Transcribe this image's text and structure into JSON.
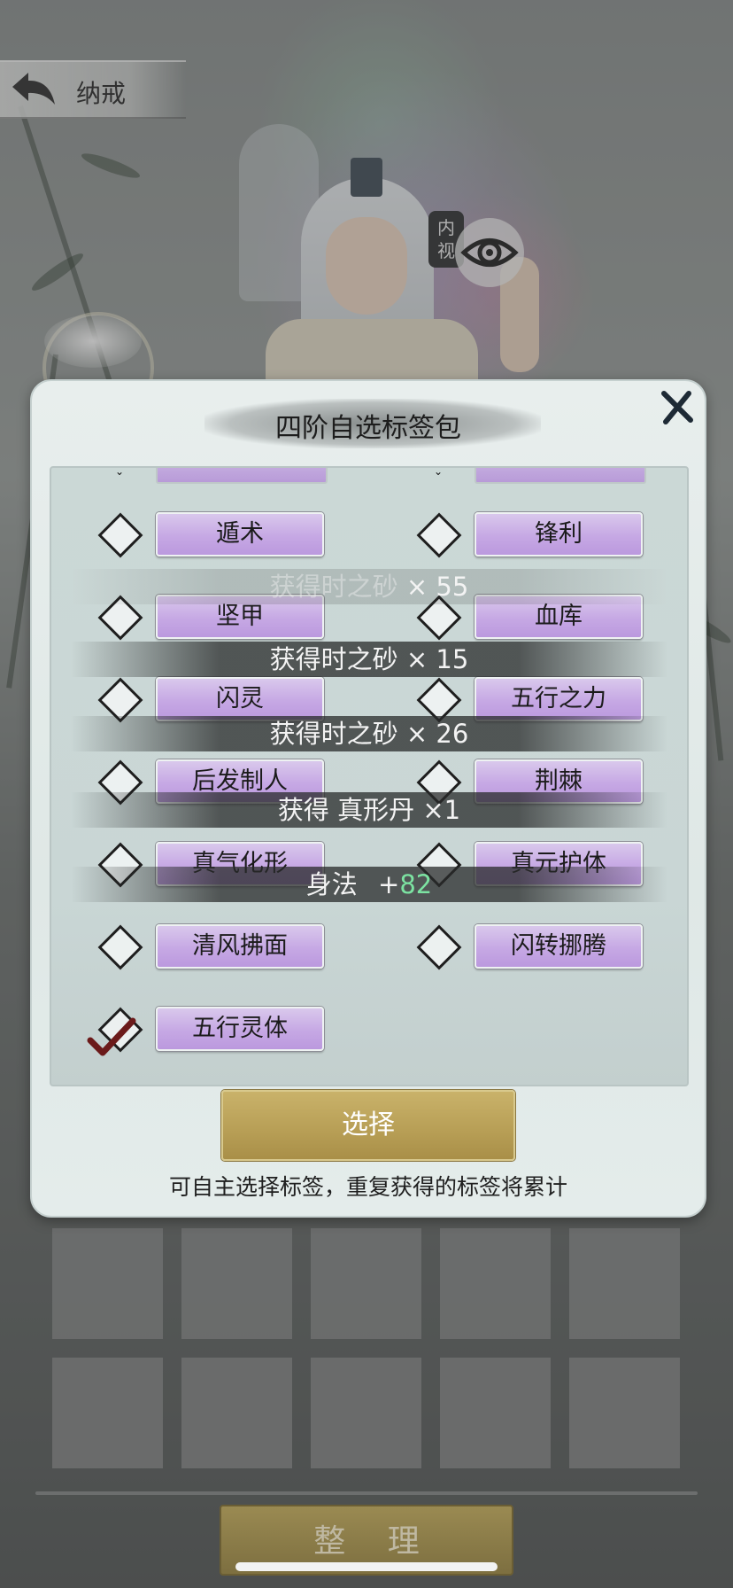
{
  "nav": {
    "title": "纳戒",
    "back_icon": "back-arrow-icon"
  },
  "character": {
    "inner_view_label": "内视",
    "eye_icon": "eye-icon"
  },
  "dialog": {
    "title": "四阶自选标签包",
    "close_icon": "close-x-icon",
    "tags_left": [
      "遁术",
      "坚甲",
      "闪灵",
      "后发制人",
      "真气化形",
      "清风拂面",
      "五行灵体"
    ],
    "tags_right": [
      "锋利",
      "血库",
      "五行之力",
      "荆棘",
      "真元护体",
      "闪转挪腾"
    ],
    "checked_tag": "五行灵体",
    "select_label": "选择",
    "hint": "可自主选择标签，重复获得的标签将累计"
  },
  "toasts": [
    {
      "prefix": "获得时之砂",
      "value": "× 55"
    },
    {
      "prefix": "获得时之砂",
      "value": "× 15"
    },
    {
      "prefix": "获得时之砂",
      "value": "× 26"
    },
    {
      "prefix": "获得 真形丹",
      "value": "×1"
    },
    {
      "prefix": "身法",
      "value": "+",
      "bonus": "82"
    }
  ],
  "inventory": {
    "sort_label": "整 理"
  },
  "colors": {
    "tag_purple": "#c6a8e4",
    "gold_button": "#b79e55",
    "bonus_green": "#7ce3a2"
  }
}
